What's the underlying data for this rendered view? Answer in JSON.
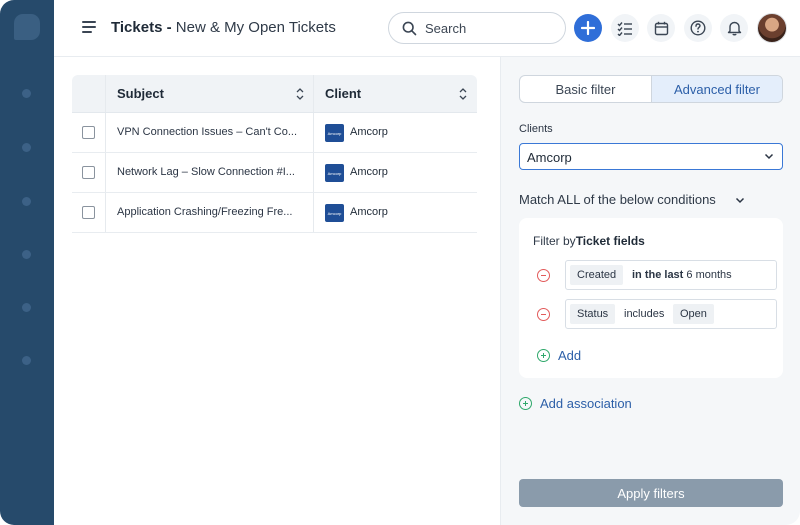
{
  "header": {
    "title_strong": "Tickets -",
    "title_light": "New & My Open Tickets",
    "search_placeholder": "Search",
    "icons": [
      "menu-icon",
      "search-icon",
      "plus-icon",
      "checklist-icon",
      "calendar-icon",
      "help-icon",
      "bell-icon",
      "avatar"
    ]
  },
  "table": {
    "columns": [
      "Subject",
      "Client"
    ],
    "rows": [
      {
        "subject": "VPN Connection Issues – Can't Co...",
        "client": "Amcorp"
      },
      {
        "subject": "Network Lag – Slow Connection #I...",
        "client": "Amcorp"
      },
      {
        "subject": "Application Crashing/Freezing Fre...",
        "client": "Amcorp"
      }
    ],
    "client_logo_text": "Amcorp"
  },
  "filter": {
    "tabs": [
      "Basic filter",
      "Advanced filter"
    ],
    "active_tab": "Advanced filter",
    "clients_label": "Clients",
    "clients_value": "Amcorp",
    "match_label": "Match ALL of the below conditions",
    "filter_by_prefix": "Filter by",
    "filter_by_strong": "Ticket fields",
    "conditions": [
      {
        "field": "Created",
        "operator": "in the last",
        "value": "6 months"
      },
      {
        "field": "Status",
        "operator": "includes",
        "value": "Open"
      }
    ],
    "add_label": "Add",
    "add_association_label": "Add association",
    "apply_label": "Apply filters"
  },
  "colors": {
    "rail": "#264a6b",
    "accent": "#2f6ed8",
    "link": "#2c5fa8",
    "remove": "#e25b5b",
    "add": "#2fa86b",
    "apply_disabled": "#8a9bab"
  }
}
